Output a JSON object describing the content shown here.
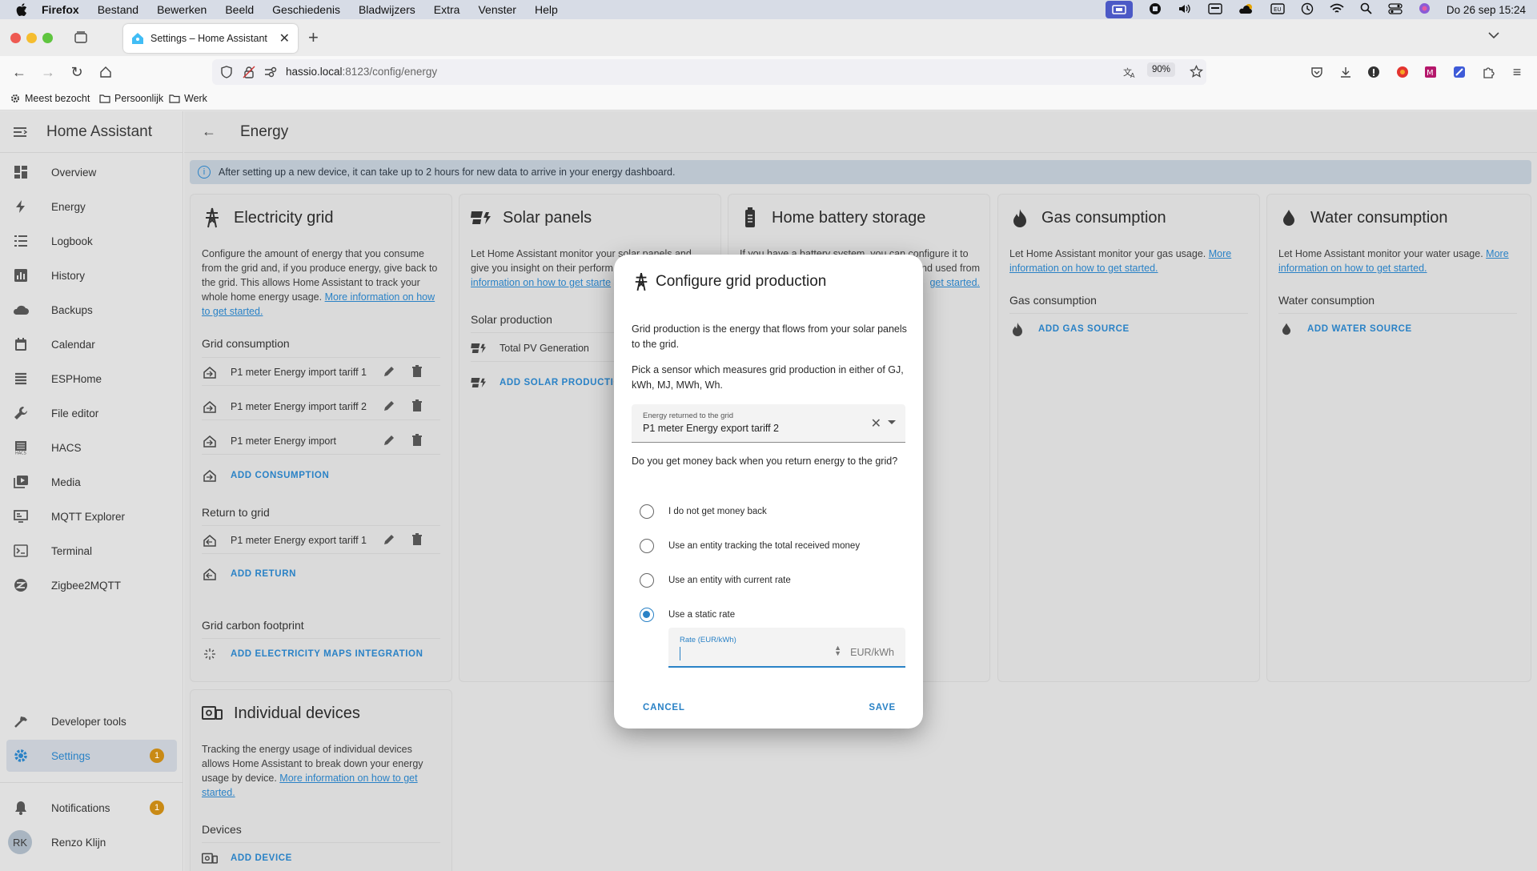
{
  "menubar": {
    "app": "Firefox",
    "items": [
      "Bestand",
      "Bewerken",
      "Beeld",
      "Geschiedenis",
      "Bladwijzers",
      "Extra",
      "Venster",
      "Help"
    ],
    "clock": "Do 26 sep  15:24"
  },
  "browser": {
    "tab_title": "Settings – Home Assistant",
    "url_host": "hassio.local",
    "url_path": ":8123/config/energy",
    "zoom": "90%",
    "bookmarks": [
      "Meest bezocht",
      "Persoonlijk",
      "Werk"
    ]
  },
  "sidebar": {
    "title": "Home Assistant",
    "items": [
      {
        "label": "Overview",
        "icon": "dashboard-icon"
      },
      {
        "label": "Energy",
        "icon": "lightning-icon"
      },
      {
        "label": "Logbook",
        "icon": "logbook-icon"
      },
      {
        "label": "History",
        "icon": "chart-icon"
      },
      {
        "label": "Backups",
        "icon": "cloud-icon"
      },
      {
        "label": "Calendar",
        "icon": "calendar-icon"
      },
      {
        "label": "ESPHome",
        "icon": "esphome-icon"
      },
      {
        "label": "File editor",
        "icon": "wrench-icon"
      },
      {
        "label": "HACS",
        "icon": "hacs-icon"
      },
      {
        "label": "Media",
        "icon": "media-icon"
      },
      {
        "label": "MQTT Explorer",
        "icon": "mqtt-icon"
      },
      {
        "label": "Terminal",
        "icon": "terminal-icon"
      },
      {
        "label": "Zigbee2MQTT",
        "icon": "zigbee-icon"
      }
    ],
    "developer_tools": "Developer tools",
    "settings": "Settings",
    "settings_badge": "1",
    "notifications": "Notifications",
    "notifications_badge": "1",
    "user_initials": "RK",
    "user_name": "Renzo Klijn"
  },
  "page": {
    "title": "Energy",
    "alert": "After setting up a new device, it can take up to 2 hours for new data to arrive in your energy dashboard."
  },
  "grid_card": {
    "title": "Electricity grid",
    "desc": "Configure the amount of energy that you consume from the grid and, if you produce energy, give back to the grid. This allows Home Assistant to track your whole home energy usage.",
    "more": "More information on how to get started.",
    "consumption_title": "Grid consumption",
    "consumption": [
      "P1 meter Energy import tariff 1",
      "P1 meter Energy import tariff 2",
      "P1 meter Energy import"
    ],
    "add_consumption": "ADD CONSUMPTION",
    "return_title": "Return to grid",
    "returns": [
      "P1 meter Energy export tariff 1"
    ],
    "add_return": "ADD RETURN",
    "carbon_title": "Grid carbon footprint",
    "add_carbon": "ADD ELECTRICITY MAPS INTEGRATION"
  },
  "solar_card": {
    "title": "Solar panels",
    "desc_1": "Let Home Assistant monitor your solar panels and",
    "desc_2": "give you insight on their perform",
    "more": "information on how to get starte",
    "section": "Solar production",
    "item": "Total PV Generation",
    "add": "ADD SOLAR PRODUCTIO"
  },
  "battery_card": {
    "title": "Home battery storage",
    "desc_1": "If you have a battery system, you can configure it to",
    "desc_2": "nd used from",
    "more": "get started."
  },
  "gas_card": {
    "title": "Gas consumption",
    "desc": "Let Home Assistant monitor your gas usage.",
    "more": "More information on how to get started.",
    "section": "Gas consumption",
    "add": "ADD GAS SOURCE"
  },
  "water_card": {
    "title": "Water consumption",
    "desc": "Let Home Assistant monitor your water usage.",
    "more": "More information on how to get started.",
    "section": "Water consumption",
    "add": "ADD WATER SOURCE"
  },
  "devices_card": {
    "title": "Individual devices",
    "desc": "Tracking the energy usage of individual devices allows Home Assistant to break down your energy usage by device.",
    "more": "More information on how to get started.",
    "section": "Devices",
    "add": "ADD DEVICE"
  },
  "dialog": {
    "title": "Configure grid production",
    "text_1": "Grid production is the energy that flows from your solar panels to the grid.",
    "text_2": "Pick a sensor which measures grid production in either of GJ, kWh, MJ, MWh, Wh.",
    "select_label": "Energy returned to the grid",
    "select_value": "P1 meter Energy export tariff 2",
    "question": "Do you get money back when you return energy to the grid?",
    "options": [
      "I do not get money back",
      "Use an entity tracking the total received money",
      "Use an entity with current rate",
      "Use a static rate"
    ],
    "selected_option": 3,
    "rate_label": "Rate (EUR/kWh)",
    "rate_unit": "EUR/kWh",
    "cancel": "CANCEL",
    "save": "SAVE"
  }
}
